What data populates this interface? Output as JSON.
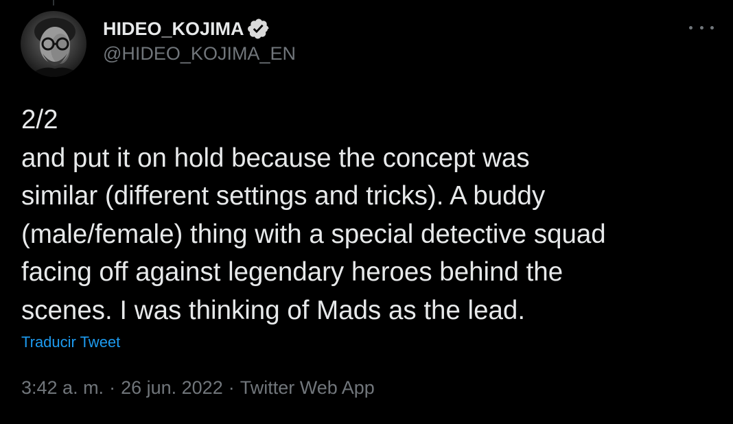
{
  "author": {
    "display_name": "HIDEO_KOJIMA",
    "handle": "@HIDEO_KOJIMA_EN",
    "verified": true
  },
  "tweet": {
    "text": "2/2\nand put it on hold because the concept was\nsimilar (different settings and tricks). A buddy\n(male/female) thing with a special detective squad\nfacing off against legendary heroes behind the\nscenes. I was thinking of Mads as the lead.",
    "translate_label": "Traducir Tweet",
    "time": "3:42 a. m.",
    "separator": "·",
    "date": "26 jun. 2022",
    "source": "Twitter Web App"
  },
  "icons": {
    "verified": "verified-badge-icon",
    "more": "more-options-icon"
  },
  "colors": {
    "background": "#000000",
    "text_primary": "#e7e9ea",
    "text_secondary": "#71767b",
    "link": "#1d9bf0"
  }
}
